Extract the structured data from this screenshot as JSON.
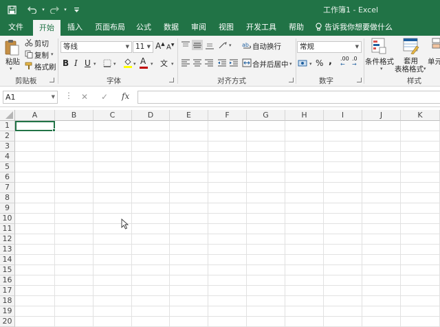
{
  "titlebar": {
    "title": "工作簿1  -  Excel",
    "quick_access": [
      "save-icon",
      "undo-icon",
      "redo-icon"
    ]
  },
  "tabs": [
    {
      "label": "文件",
      "active": false
    },
    {
      "label": "开始",
      "active": true
    },
    {
      "label": "插入",
      "active": false
    },
    {
      "label": "页面布局",
      "active": false
    },
    {
      "label": "公式",
      "active": false
    },
    {
      "label": "数据",
      "active": false
    },
    {
      "label": "审阅",
      "active": false
    },
    {
      "label": "视图",
      "active": false
    },
    {
      "label": "开发工具",
      "active": false
    },
    {
      "label": "帮助",
      "active": false
    }
  ],
  "tell_me": "告诉我你想要做什么",
  "ribbon": {
    "clipboard": {
      "paste": "粘贴",
      "cut": "剪切",
      "copy": "复制",
      "format_painter": "格式刷",
      "group": "剪贴板"
    },
    "font": {
      "font_name": "等线",
      "font_size": "11",
      "bold": "B",
      "italic": "I",
      "underline": "U",
      "grow": "A",
      "shrink": "A",
      "font_color_letter": "A",
      "phonetic": "文",
      "group": "字体"
    },
    "alignment": {
      "wrap_text": "自动换行",
      "merge_center": "合并后居中",
      "group": "对齐方式"
    },
    "number": {
      "format": "常规",
      "percent": "%",
      "comma": ",",
      "increase_decimal": ".00",
      "group": "数字"
    },
    "styles": {
      "conditional": "条件格式",
      "table_line1": "套用",
      "table_line2": "表格格式",
      "cell_styles": "单元",
      "group": "样式"
    }
  },
  "formula_bar": {
    "name_box": "A1",
    "cancel": "✕",
    "enter": "✓",
    "fx": "fx",
    "value": ""
  },
  "sheet": {
    "columns": [
      "A",
      "B",
      "C",
      "D",
      "E",
      "F",
      "G",
      "H",
      "I",
      "J",
      "K"
    ],
    "rows": [
      "1",
      "2",
      "3",
      "4",
      "5",
      "6",
      "7",
      "8",
      "9",
      "10",
      "11",
      "12",
      "13",
      "14",
      "15",
      "16",
      "17",
      "18",
      "19",
      "20"
    ],
    "selected_cell": "A1"
  },
  "colors": {
    "accent": "#217346",
    "ribbon_bg": "#f3f3f3",
    "font_color_bar": "#c00000",
    "fill_color_bar": "#ffff00"
  }
}
